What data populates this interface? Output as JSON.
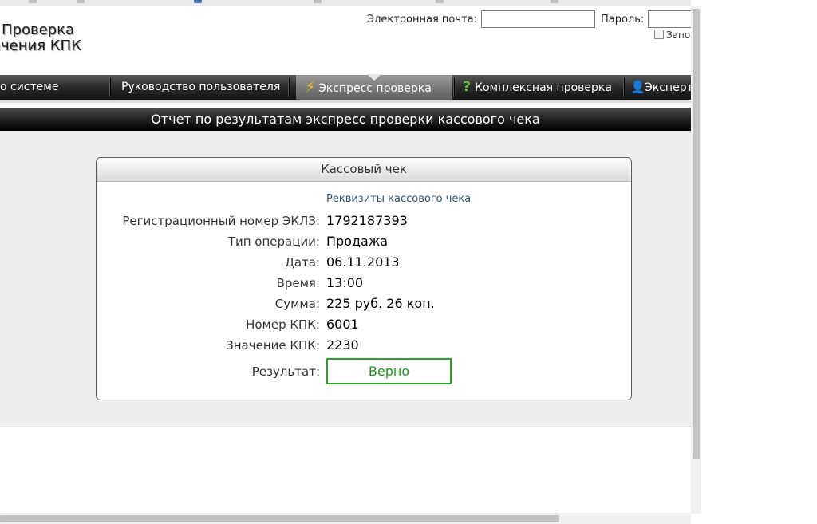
{
  "header": {
    "logo_line1": "Проверка",
    "logo_line2": "ачения КПК",
    "email_label": "Электронная почта:",
    "password_label": "Пароль:",
    "remember_label": "Запо"
  },
  "nav": {
    "items": [
      {
        "label": "о системе"
      },
      {
        "label": "Руководство пользователя"
      },
      {
        "label": "Экспресс проверка",
        "icon": "lightning-icon"
      },
      {
        "label": "Комплексная проверка",
        "icon": "question-icon"
      },
      {
        "label": "Эксперт",
        "icon": "user-icon"
      }
    ],
    "active": "Экспресс проверка"
  },
  "report": {
    "title": "Отчет по результатам экспресс проверки кассового чека"
  },
  "receipt": {
    "header": "Кассовый чек",
    "details_link": "Реквизиты кассового чека",
    "rows": [
      {
        "label": "Регистрационный номер ЭКЛЗ:",
        "value": "1792187393"
      },
      {
        "label": "Тип операции:",
        "value": "Продажа"
      },
      {
        "label": "Дата:",
        "value": "06.11.2013"
      },
      {
        "label": "Время:",
        "value": "13:00"
      },
      {
        "label": "Сумма:",
        "value": "225 руб. 26 коп."
      },
      {
        "label": "Номер КПК:",
        "value": "6001"
      },
      {
        "label": "Значение КПК:",
        "value": "2230"
      }
    ],
    "result_label": "Результат:",
    "result_value": "Верно"
  },
  "colors": {
    "result_border": "#28a428",
    "link": "#2c5473"
  }
}
